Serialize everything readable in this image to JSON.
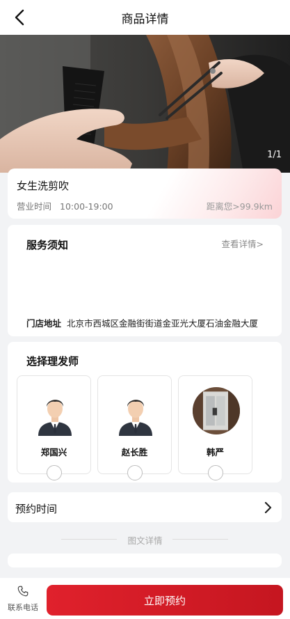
{
  "navbar": {
    "title": "商品详情",
    "back_icon": "chevron-left-icon"
  },
  "hero": {
    "counter": "1/1"
  },
  "product": {
    "name": "女生洗剪吹",
    "hours_label": "营业时间",
    "hours_value": "10:00-19:00",
    "distance": "距离您>99.9km"
  },
  "notice": {
    "title": "服务须知",
    "link": "查看详情>",
    "address_label": "门店地址",
    "address_value": "北京市西城区金融街街道金亚光大厦石油金融大厦"
  },
  "barbers": {
    "title": "选择理发师",
    "items": [
      {
        "name": "郑国兴",
        "avatar": "male-avatar-icon"
      },
      {
        "name": "赵长胜",
        "avatar": "male-avatar-icon"
      },
      {
        "name": "韩严",
        "avatar": "photo-avatar"
      }
    ]
  },
  "appointment": {
    "label": "预约时间",
    "icon": "chevron-right-icon"
  },
  "detail_divider": {
    "text": "图文详情"
  },
  "bottom": {
    "contact_label": "联系电话",
    "contact_icon": "phone-icon",
    "book_label": "立即预约"
  },
  "colors": {
    "accent": "#d81e28",
    "background": "#f2f3f5"
  }
}
